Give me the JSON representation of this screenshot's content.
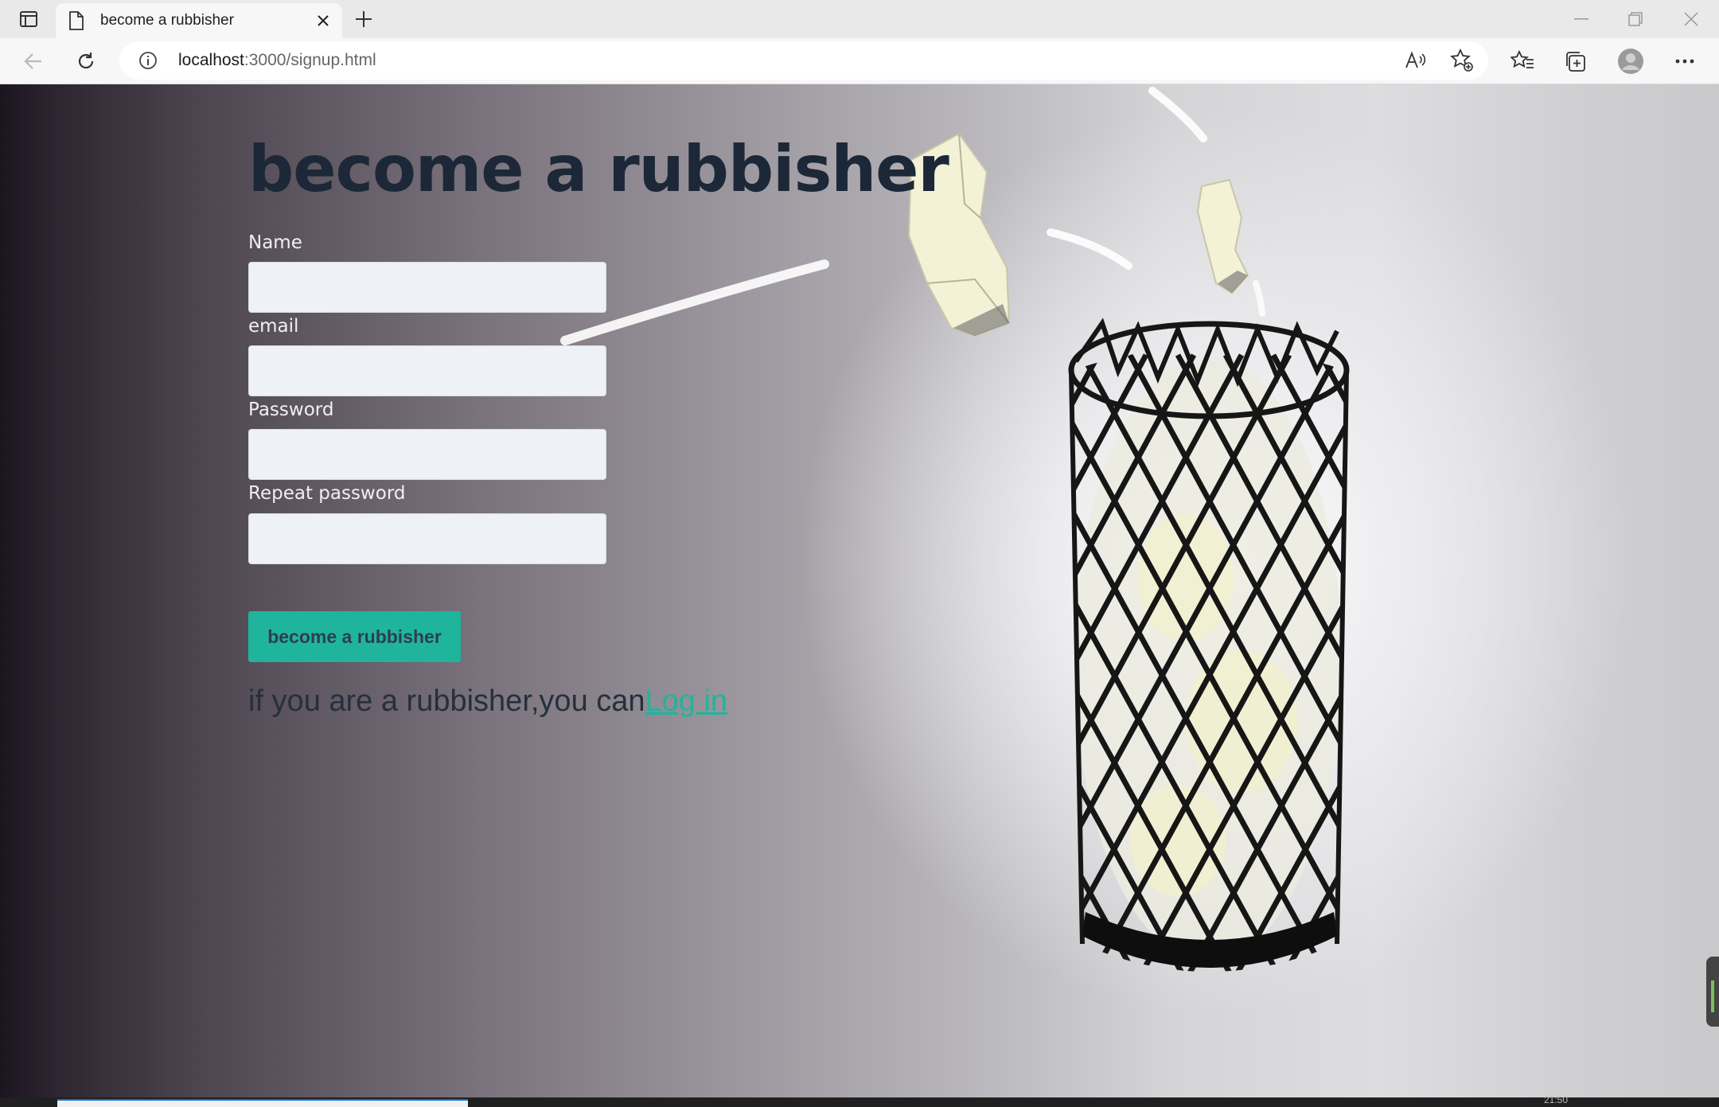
{
  "browser": {
    "tab_title": "become a rubbisher",
    "url_host": "localhost",
    "url_rest": ":3000/signup.html"
  },
  "page": {
    "title": "become a rubbisher",
    "fields": {
      "name_label": "Name",
      "email_label": "email",
      "password_label": "Password",
      "repeat_label": "Repeat password"
    },
    "submit_label": "become a rubbisher",
    "login_prompt": "if you are a rubbisher,you can",
    "login_link": "Log in"
  },
  "taskbar": {
    "clock": "21:50"
  },
  "colors": {
    "accent": "#1fb59d",
    "title": "#1c2837"
  }
}
